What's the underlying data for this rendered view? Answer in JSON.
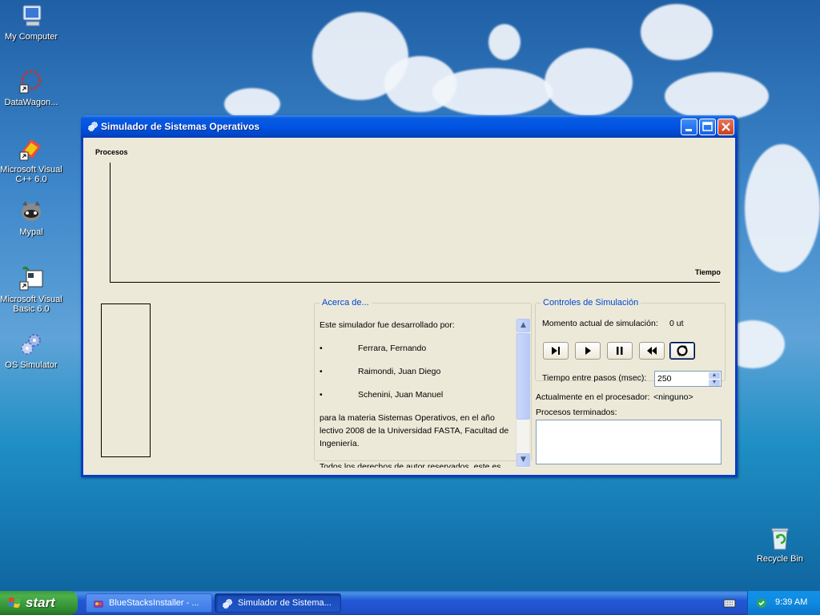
{
  "desktop": {
    "icons": [
      {
        "label": "My Computer",
        "icon": "my-computer-icon"
      },
      {
        "label": "DataWagon...",
        "icon": "datawagon-icon"
      },
      {
        "label": "Microsoft Visual C++ 6.0",
        "icon": "visual-cpp-icon"
      },
      {
        "label": "Mypal",
        "icon": "mypal-icon"
      },
      {
        "label": "Microsoft Visual Basic 6.0",
        "icon": "visual-basic-icon"
      },
      {
        "label": "OS Simulator",
        "icon": "os-simulator-icon"
      },
      {
        "label": "Recycle Bin",
        "icon": "recycle-bin-icon"
      }
    ]
  },
  "window": {
    "title": "Simulador de Sistemas Operativos",
    "chart": {
      "y_label": "Procesos",
      "x_label": "Tiempo"
    },
    "about": {
      "legend": "Acerca de...",
      "intro": "Este simulador fue desarrollado por:",
      "authors": [
        "Ferrara, Fernando",
        "Raimondi, Juan Diego",
        "Schenini, Juan Manuel"
      ],
      "body": "para la materia Sistemas Operativos, en el año lectivo 2008 de la Universidad FASTA, Facultad de Ingeniería.",
      "footer": "Todos los derechos de autor reservados, este es"
    },
    "controls": {
      "legend": "Controles de Simulación",
      "moment_label": "Momento actual de simulación:",
      "moment_value": "0 ut",
      "buttons": [
        "step-forward",
        "play",
        "pause",
        "rewind",
        "reset"
      ],
      "step_label": "Tiempo entre pasos (msec):",
      "step_value": "250"
    },
    "processor_label": "Actualmente en el procesador:",
    "processor_value": "<ninguno>",
    "finished_label": "Procesos terminados:"
  },
  "taskbar": {
    "start_label": "start",
    "tasks": [
      {
        "label": "BlueStacksInstaller - ...",
        "active": false
      },
      {
        "label": "Simulador de Sistema...",
        "active": true
      }
    ],
    "clock": "9:39 AM"
  },
  "colors": {
    "title_bar": "#0054e3",
    "window_bg": "#ece9d8",
    "legend_text": "#0046d5",
    "start_green": "#3c9c3c"
  }
}
